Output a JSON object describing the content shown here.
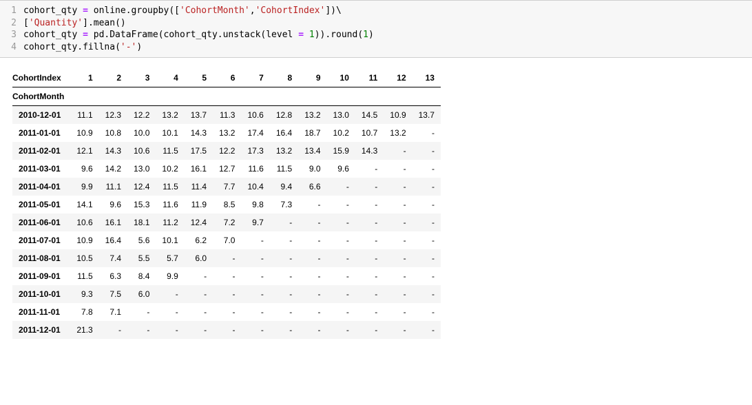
{
  "code": {
    "lines": [
      {
        "n": "1",
        "tokens": [
          {
            "t": "cohort_qty ",
            "c": "t-id"
          },
          {
            "t": "=",
            "c": "t-op"
          },
          {
            "t": " online",
            "c": "t-id"
          },
          {
            "t": ".",
            "c": "t-p"
          },
          {
            "t": "groupby",
            "c": "t-id"
          },
          {
            "t": "([",
            "c": "t-p"
          },
          {
            "t": "'CohortMonth'",
            "c": "t-str"
          },
          {
            "t": ",",
            "c": "t-p"
          },
          {
            "t": "'CohortIndex'",
            "c": "t-str"
          },
          {
            "t": "])\\",
            "c": "t-p"
          }
        ]
      },
      {
        "n": "2",
        "tokens": [
          {
            "t": "[",
            "c": "t-p"
          },
          {
            "t": "'Quantity'",
            "c": "t-str"
          },
          {
            "t": "]",
            "c": "t-p"
          },
          {
            "t": ".",
            "c": "t-p"
          },
          {
            "t": "mean",
            "c": "t-id"
          },
          {
            "t": "()",
            "c": "t-p"
          }
        ]
      },
      {
        "n": "3",
        "tokens": [
          {
            "t": "cohort_qty ",
            "c": "t-id"
          },
          {
            "t": "=",
            "c": "t-op"
          },
          {
            "t": " pd",
            "c": "t-id"
          },
          {
            "t": ".",
            "c": "t-p"
          },
          {
            "t": "DataFrame",
            "c": "t-id"
          },
          {
            "t": "(cohort_qty",
            "c": "t-p"
          },
          {
            "t": ".",
            "c": "t-p"
          },
          {
            "t": "unstack",
            "c": "t-id"
          },
          {
            "t": "(level ",
            "c": "t-p"
          },
          {
            "t": "=",
            "c": "t-op"
          },
          {
            "t": " ",
            "c": "t-p"
          },
          {
            "t": "1",
            "c": "t-num"
          },
          {
            "t": "))",
            "c": "t-p"
          },
          {
            "t": ".",
            "c": "t-p"
          },
          {
            "t": "round",
            "c": "t-id"
          },
          {
            "t": "(",
            "c": "t-p"
          },
          {
            "t": "1",
            "c": "t-num"
          },
          {
            "t": ")",
            "c": "t-p"
          }
        ]
      },
      {
        "n": "4",
        "tokens": [
          {
            "t": "cohort_qty",
            "c": "t-id"
          },
          {
            "t": ".",
            "c": "t-p"
          },
          {
            "t": "fillna",
            "c": "t-id"
          },
          {
            "t": "(",
            "c": "t-p"
          },
          {
            "t": "'-'",
            "c": "t-str"
          },
          {
            "t": ")",
            "c": "t-p"
          }
        ]
      }
    ]
  },
  "table": {
    "col_index_name": "CohortIndex",
    "row_index_name": "CohortMonth",
    "columns": [
      "1",
      "2",
      "3",
      "4",
      "5",
      "6",
      "7",
      "8",
      "9",
      "10",
      "11",
      "12",
      "13"
    ],
    "rows": [
      {
        "label": "2010-12-01",
        "cells": [
          "11.1",
          "12.3",
          "12.2",
          "13.2",
          "13.7",
          "11.3",
          "10.6",
          "12.8",
          "13.2",
          "13.0",
          "14.5",
          "10.9",
          "13.7"
        ]
      },
      {
        "label": "2011-01-01",
        "cells": [
          "10.9",
          "10.8",
          "10.0",
          "10.1",
          "14.3",
          "13.2",
          "17.4",
          "16.4",
          "18.7",
          "10.2",
          "10.7",
          "13.2",
          "-"
        ]
      },
      {
        "label": "2011-02-01",
        "cells": [
          "12.1",
          "14.3",
          "10.6",
          "11.5",
          "17.5",
          "12.2",
          "17.3",
          "13.2",
          "13.4",
          "15.9",
          "14.3",
          "-",
          "-"
        ]
      },
      {
        "label": "2011-03-01",
        "cells": [
          "9.6",
          "14.2",
          "13.0",
          "10.2",
          "16.1",
          "12.7",
          "11.6",
          "11.5",
          "9.0",
          "9.6",
          "-",
          "-",
          "-"
        ]
      },
      {
        "label": "2011-04-01",
        "cells": [
          "9.9",
          "11.1",
          "12.4",
          "11.5",
          "11.4",
          "7.7",
          "10.4",
          "9.4",
          "6.6",
          "-",
          "-",
          "-",
          "-"
        ]
      },
      {
        "label": "2011-05-01",
        "cells": [
          "14.1",
          "9.6",
          "15.3",
          "11.6",
          "11.9",
          "8.5",
          "9.8",
          "7.3",
          "-",
          "-",
          "-",
          "-",
          "-"
        ]
      },
      {
        "label": "2011-06-01",
        "cells": [
          "10.6",
          "16.1",
          "18.1",
          "11.2",
          "12.4",
          "7.2",
          "9.7",
          "-",
          "-",
          "-",
          "-",
          "-",
          "-"
        ]
      },
      {
        "label": "2011-07-01",
        "cells": [
          "10.9",
          "16.4",
          "5.6",
          "10.1",
          "6.2",
          "7.0",
          "-",
          "-",
          "-",
          "-",
          "-",
          "-",
          "-"
        ]
      },
      {
        "label": "2011-08-01",
        "cells": [
          "10.5",
          "7.4",
          "5.5",
          "5.7",
          "6.0",
          "-",
          "-",
          "-",
          "-",
          "-",
          "-",
          "-",
          "-"
        ]
      },
      {
        "label": "2011-09-01",
        "cells": [
          "11.5",
          "6.3",
          "8.4",
          "9.9",
          "-",
          "-",
          "-",
          "-",
          "-",
          "-",
          "-",
          "-",
          "-"
        ]
      },
      {
        "label": "2011-10-01",
        "cells": [
          "9.3",
          "7.5",
          "6.0",
          "-",
          "-",
          "-",
          "-",
          "-",
          "-",
          "-",
          "-",
          "-",
          "-"
        ]
      },
      {
        "label": "2011-11-01",
        "cells": [
          "7.8",
          "7.1",
          "-",
          "-",
          "-",
          "-",
          "-",
          "-",
          "-",
          "-",
          "-",
          "-",
          "-"
        ]
      },
      {
        "label": "2011-12-01",
        "cells": [
          "21.3",
          "-",
          "-",
          "-",
          "-",
          "-",
          "-",
          "-",
          "-",
          "-",
          "-",
          "-",
          "-"
        ]
      }
    ]
  }
}
